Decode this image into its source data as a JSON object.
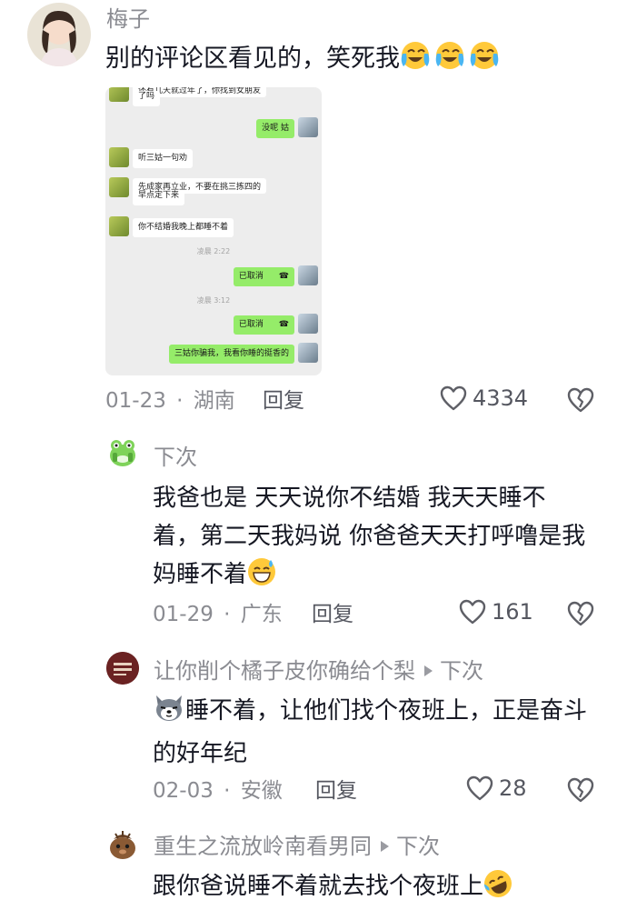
{
  "comments": [
    {
      "username": "梅子",
      "text": "别的评论区看见的，笑死我",
      "emoji": "crying-laughing-emoji ×3",
      "date": "01-23",
      "location": "湖南",
      "reply_label": "回复",
      "likes": "4334"
    },
    {
      "username": "下次",
      "text": "我爸也是 天天说你不结婚 我天天睡不着，第二天我妈说 你爸爸天天打呼噜是我妈睡不着",
      "date": "01-29",
      "location": "广东",
      "reply_label": "回复",
      "likes": "161"
    },
    {
      "username": "让你削个橘子皮你确给个梨",
      "reply_to": "下次",
      "text": "睡不着，让他们找个夜班上，正是奋斗的好年纪",
      "date": "02-03",
      "location": "安徽",
      "reply_label": "回复",
      "likes": "28"
    },
    {
      "username": "重生之流放岭南看男同",
      "reply_to": "下次",
      "text": "跟你爸说睡不着就去找个夜班上"
    }
  ],
  "chat_screenshot": {
    "messages": [
      {
        "side": "left",
        "text": "还有几天就过年了，你找到女朋友"
      },
      {
        "side": "left",
        "text": "了吗"
      },
      {
        "side": "right",
        "text": "没呢 姑"
      },
      {
        "side": "left",
        "text": "听三姑一句劝"
      },
      {
        "side": "left",
        "text": "先成家再立业，不要在挑三拣四的"
      },
      {
        "side": "left",
        "text": "早点定下来"
      },
      {
        "side": "left",
        "text": "你不结婚我晚上都睡不着"
      },
      {
        "side": "time",
        "text": "凌晨 2:22"
      },
      {
        "side": "right",
        "text": "已取消"
      },
      {
        "side": "time",
        "text": "凌晨 3:12"
      },
      {
        "side": "right",
        "text": "已取消"
      },
      {
        "side": "right",
        "text": "三姑你骗我，我看你睡的挺香的"
      }
    ]
  },
  "separator": "·"
}
